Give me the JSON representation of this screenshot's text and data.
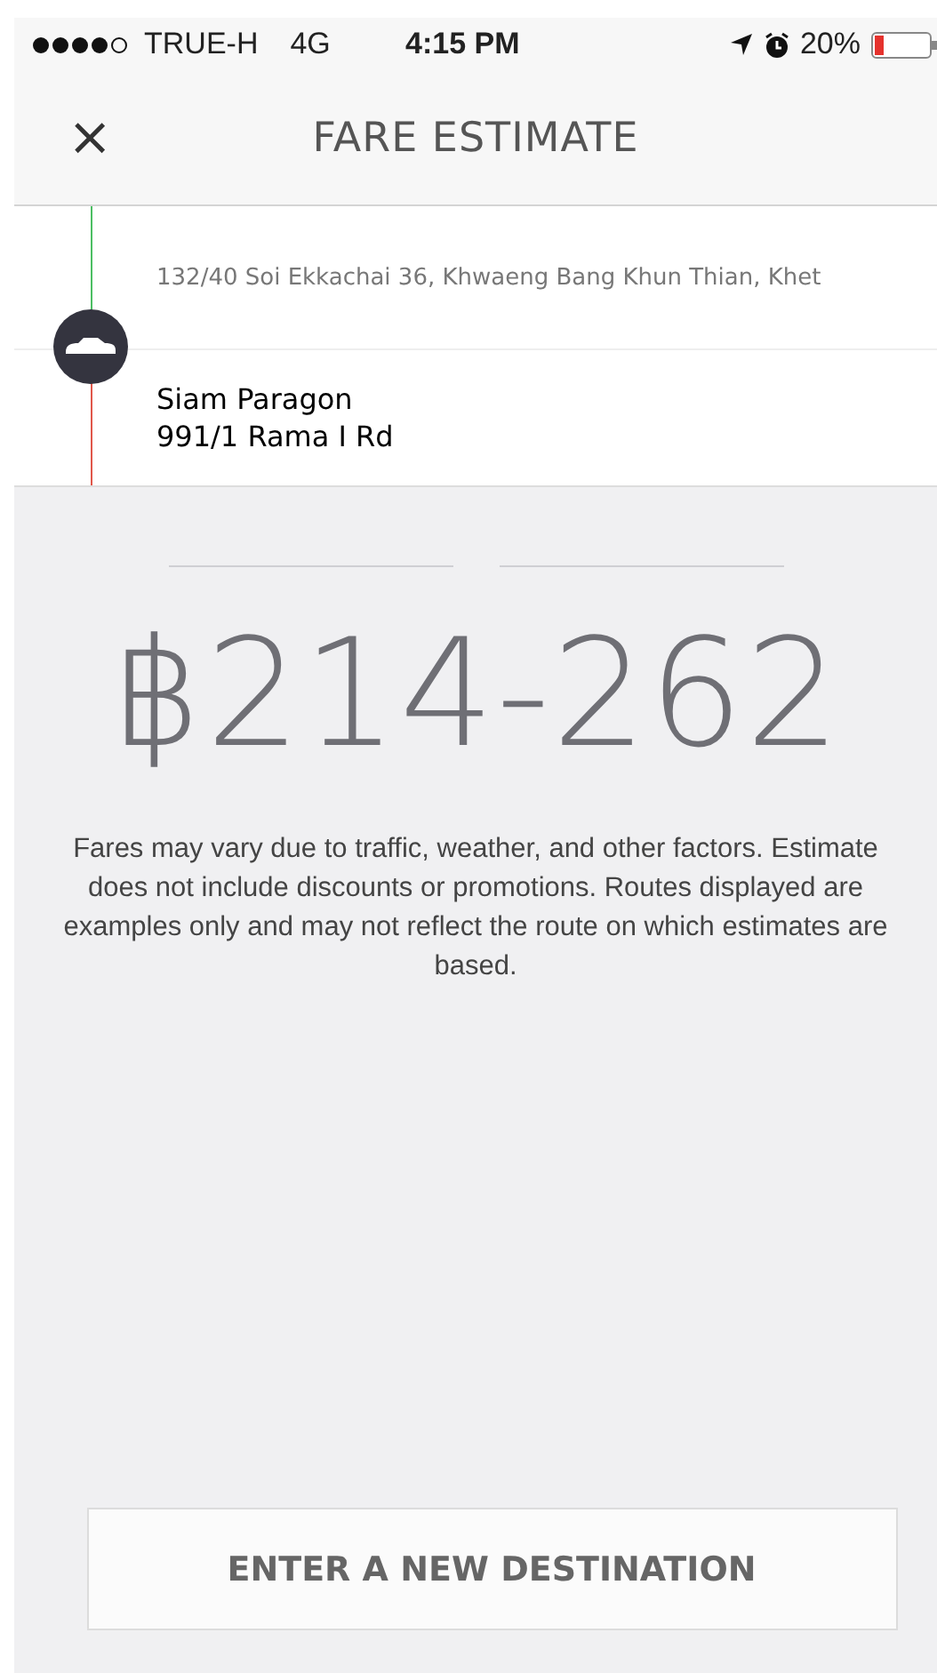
{
  "status_bar": {
    "carrier": "TRUE-H",
    "network": "4G",
    "time": "4:15 PM",
    "battery": "20%"
  },
  "header": {
    "close": "×",
    "title": "FARE ESTIMATE"
  },
  "route": {
    "pickup": {
      "address": "132/40 Soi Ekkachai 36, Khwaeng Bang Khun Thian, Khet"
    },
    "destination": {
      "name": "Siam Paragon",
      "address": "991/1 Rama I Rd"
    }
  },
  "fare": {
    "amount": "฿214-262",
    "disclaimer": "Fares may vary due to traffic, weather, and other factors. Estimate does not include discounts or promotions. Routes displayed are examples only and may not reflect the route on which estimates are based."
  },
  "buttons": [
    "ENTER A NEW DESTINATION"
  ]
}
